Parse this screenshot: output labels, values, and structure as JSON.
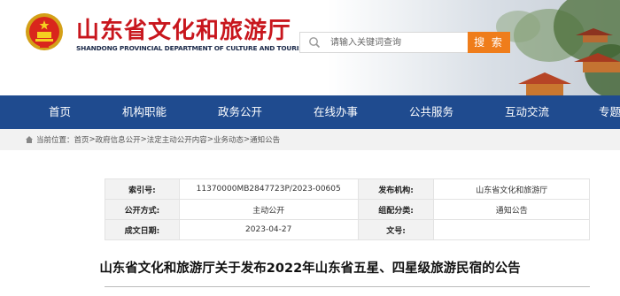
{
  "header": {
    "title": "山东省文化和旅游厅",
    "subtitle": "SHANDONG PROVINCIAL DEPARTMENT OF CULTURE AND TOURISM",
    "search_placeholder": "请输入关键词查询",
    "search_button": "搜 索"
  },
  "nav": {
    "items": [
      {
        "label": "首页"
      },
      {
        "label": "机构职能"
      },
      {
        "label": "政务公开"
      },
      {
        "label": "在线办事"
      },
      {
        "label": "公共服务"
      },
      {
        "label": "互动交流"
      },
      {
        "label": "专题"
      }
    ]
  },
  "breadcrumb": {
    "prefix": "当前位置：",
    "items": [
      "首页",
      "政府信息公开",
      "法定主动公开内容",
      "业务动态",
      "通知公告"
    ],
    "separator": ">"
  },
  "info": {
    "index_label": "索引号:",
    "index_value": "11370000MB2847723P/2023-00605",
    "publisher_label": "发布机构:",
    "publisher_value": "山东省文化和旅游厅",
    "mode_label": "公开方式:",
    "mode_value": "主动公开",
    "category_label": "组配分类:",
    "category_value": "通知公告",
    "date_label": "成文日期:",
    "date_value": "2023-04-27",
    "doc_no_label": "文号:",
    "doc_no_value": ""
  },
  "article": {
    "title": "山东省文化和旅游厅关于发布2022年山东省五星、四星级旅游民宿的公告"
  },
  "colors": {
    "title_red": "#c8161d",
    "nav_blue": "#1f4b8f",
    "search_orange": "#ef7d1b"
  }
}
